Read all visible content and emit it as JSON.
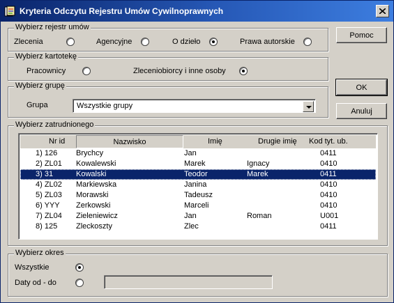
{
  "window": {
    "title": "Kryteria Odczytu Rejestru Umów Cywilnoprawnych",
    "colors": {
      "title_bar": "#0a246a",
      "face": "#d4d0c8",
      "selection": "#0a246a"
    }
  },
  "register_group": {
    "legend": "Wybierz rejestr umów",
    "options": [
      {
        "label": "Zlecenia",
        "selected": false
      },
      {
        "label": "Agencyjne",
        "selected": false
      },
      {
        "label": "O dzieło",
        "selected": true
      },
      {
        "label": "Prawa autorskie",
        "selected": false
      }
    ]
  },
  "file_group": {
    "legend": "Wybierz kartotekę",
    "options": [
      {
        "label": "Pracownicy",
        "selected": false
      },
      {
        "label": "Zleceniobiorcy i inne osoby",
        "selected": true
      }
    ]
  },
  "group_group": {
    "legend": "Wybierz grupę",
    "label": "Grupa",
    "value": "Wszystkie grupy"
  },
  "buttons": {
    "help": "Pomoc",
    "ok": "OK",
    "cancel": "Anuluj"
  },
  "employee_group": {
    "legend": "Wybierz zatrudnionego",
    "columns": [
      "Nr id",
      "Nazwisko",
      "Imię",
      "Drugie imię",
      "Kod tyt. ub."
    ],
    "rows": [
      {
        "nr": "1) 126",
        "surname": "Brychcy",
        "name": "Jan",
        "second": "",
        "code": "0411"
      },
      {
        "nr": "2) ZL01",
        "surname": "Kowalewski",
        "name": "Marek",
        "second": "Ignacy",
        "code": "0410"
      },
      {
        "nr": "3) 31",
        "surname": "Kowalski",
        "name": "Teodor",
        "second": "Marek",
        "code": "0411"
      },
      {
        "nr": "4) ZL02",
        "surname": "Markiewska",
        "name": "Janina",
        "second": "",
        "code": "0410"
      },
      {
        "nr": "5) ZL03",
        "surname": "Morawski",
        "name": "Tadeusz",
        "second": "",
        "code": "0410"
      },
      {
        "nr": "6) YYY",
        "surname": "Zerkowski",
        "name": "Marceli",
        "second": "",
        "code": "0410"
      },
      {
        "nr": "7) ZL04",
        "surname": "Zieleniewicz",
        "name": "Jan",
        "second": "Roman",
        "code": "U001"
      },
      {
        "nr": "8) 125",
        "surname": "Zleckoszty",
        "name": "Zlec",
        "second": "",
        "code": "0411"
      }
    ],
    "selected_index": 2
  },
  "period_group": {
    "legend": "Wybierz okres",
    "options": [
      {
        "label": "Wszystkie",
        "selected": true
      },
      {
        "label": "Daty od - do",
        "selected": false
      }
    ],
    "date_range_value": ""
  }
}
